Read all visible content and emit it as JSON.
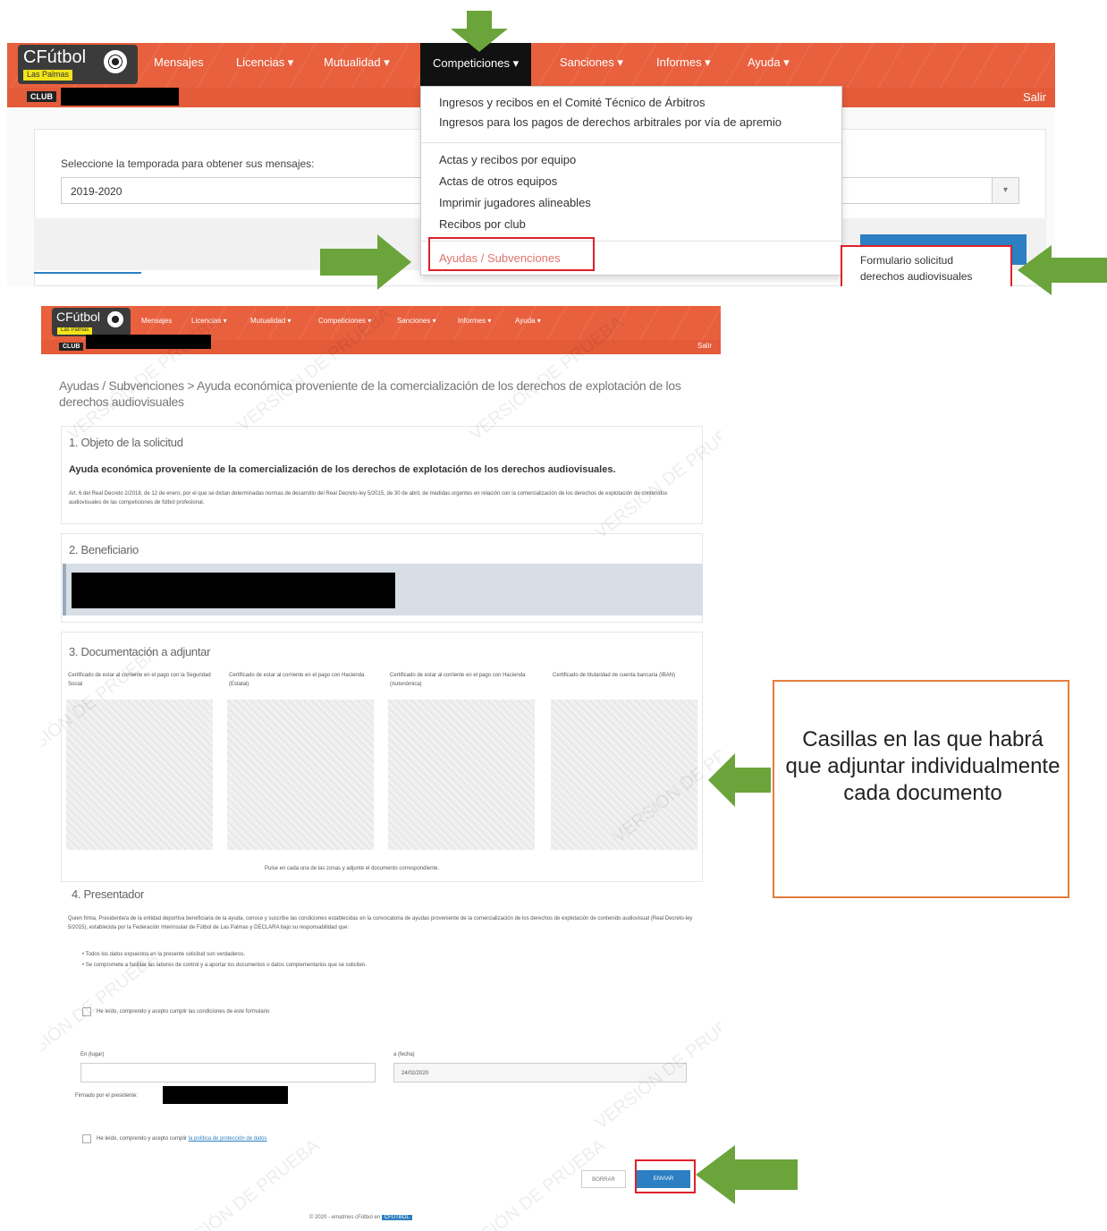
{
  "top": {
    "brand": "CFútbol",
    "brand_sub": "Las Palmas",
    "nav": [
      "Mensajes",
      "Licencias ▾",
      "Mutualidad ▾",
      "Competiciones ▾",
      "Sanciones ▾",
      "Informes ▾",
      "Ayuda ▾"
    ],
    "club_badge": "CLUB",
    "logout": "Salir",
    "season_label": "Seleccione la temporada para obtener sus mensajes:",
    "season_value": "2019-2020",
    "dropdown": {
      "items_group1": [
        "Ingresos y recibos en el Comité Técnico de Árbitros",
        "Ingresos para los pagos de derechos arbitrales por vía de apremio"
      ],
      "items_group2": [
        "Actas y recibos por equipo",
        "Actas de otros equipos",
        "Imprimir jugadores alineables",
        "Recibos por club"
      ],
      "selected": "Ayudas / Subvenciones"
    },
    "submenu": [
      "Formulario solicitud",
      "derechos audiovisuales"
    ]
  },
  "bottom": {
    "breadcrumb": "Ayudas / Subvenciones > Ayuda económica proveniente de la comercialización de los derechos de explotación de los derechos audiovisuales",
    "s1_title": "1. Objeto de la solicitud",
    "s1_heading": "Ayuda económica proveniente de la comercialización de los derechos de explotación de los derechos audiovisuales.",
    "s1_body": "Art. 6 del Real Decreto 2/2018, de 12 de enero, por el que se dictan determinadas normas de desarrollo del Real Decreto-ley 5/2015, de 30 de abril, de medidas urgentes en relación con la comercialización de los derechos de explotación de contenidos audiovisuales de las competiciones de fútbol profesional.",
    "s2_title": "2. Beneficiario",
    "s3_title": "3. Documentación a adjuntar",
    "docs": [
      "Certificado de estar al corriente en el pago con la Seguridad Social",
      "Certificado de estar al corriente en el pago con Hacienda (Estatal)",
      "Certificado de estar al corriente en el pago con Hacienda (Autonómica)",
      "Certificado de titularidad de cuenta bancaria (IBAN)"
    ],
    "drop_hint": "Pulse en cada una de las zonas y adjunte el documento correspondiente.",
    "s4_title": "4. Presentador",
    "s4_body": "Quien firma, Presidente/a de la entidad deportiva beneficiaria de la ayuda, conoce y suscribe las condiciones establecidas en la convocatoria de ayudas proveniente de la comercialización de los derechos de explotación de contenido audiovisual (Real Decreto-ley 5/2015), establecida por la Federación Interinsular de Fútbol de Las Palmas y DECLARA bajo su responsabilidad que:",
    "bullets": [
      "Todos los datos expuestos en la presente solicitud son verdaderos.",
      "Se compromete a facilitar las labores de control y a aportar los documentos o datos complementarios que se soliciten."
    ],
    "check1": "He leído, comprendo y acepto cumplir las condiciones de este formulario",
    "place_label": "En (lugar)",
    "date_label": "a (fecha)",
    "date_value": "24/02/2020",
    "signed_label": "Firmado por el presidente:",
    "check2_prefix": "He leído, comprendo y acepto cumplir ",
    "check2_link": "la política de protección de datos",
    "btn_cancel": "BORRAR",
    "btn_send": "ENVIAR",
    "footer_text": "© 2020 - ematmes cFútbol en",
    "footer_badge": "CFUTBOL"
  },
  "annotation": "Casillas en las que habrá que adjuntar individualmente cada documento",
  "watermark": "VERSIÓN DE PRUEBA",
  "colors": {
    "navbar": "#e8603e",
    "highlight_red": "#e0202a",
    "arrow_green": "#6aa43b",
    "annotation_border": "#e47d3a",
    "primary_blue": "#2b7fc2"
  }
}
